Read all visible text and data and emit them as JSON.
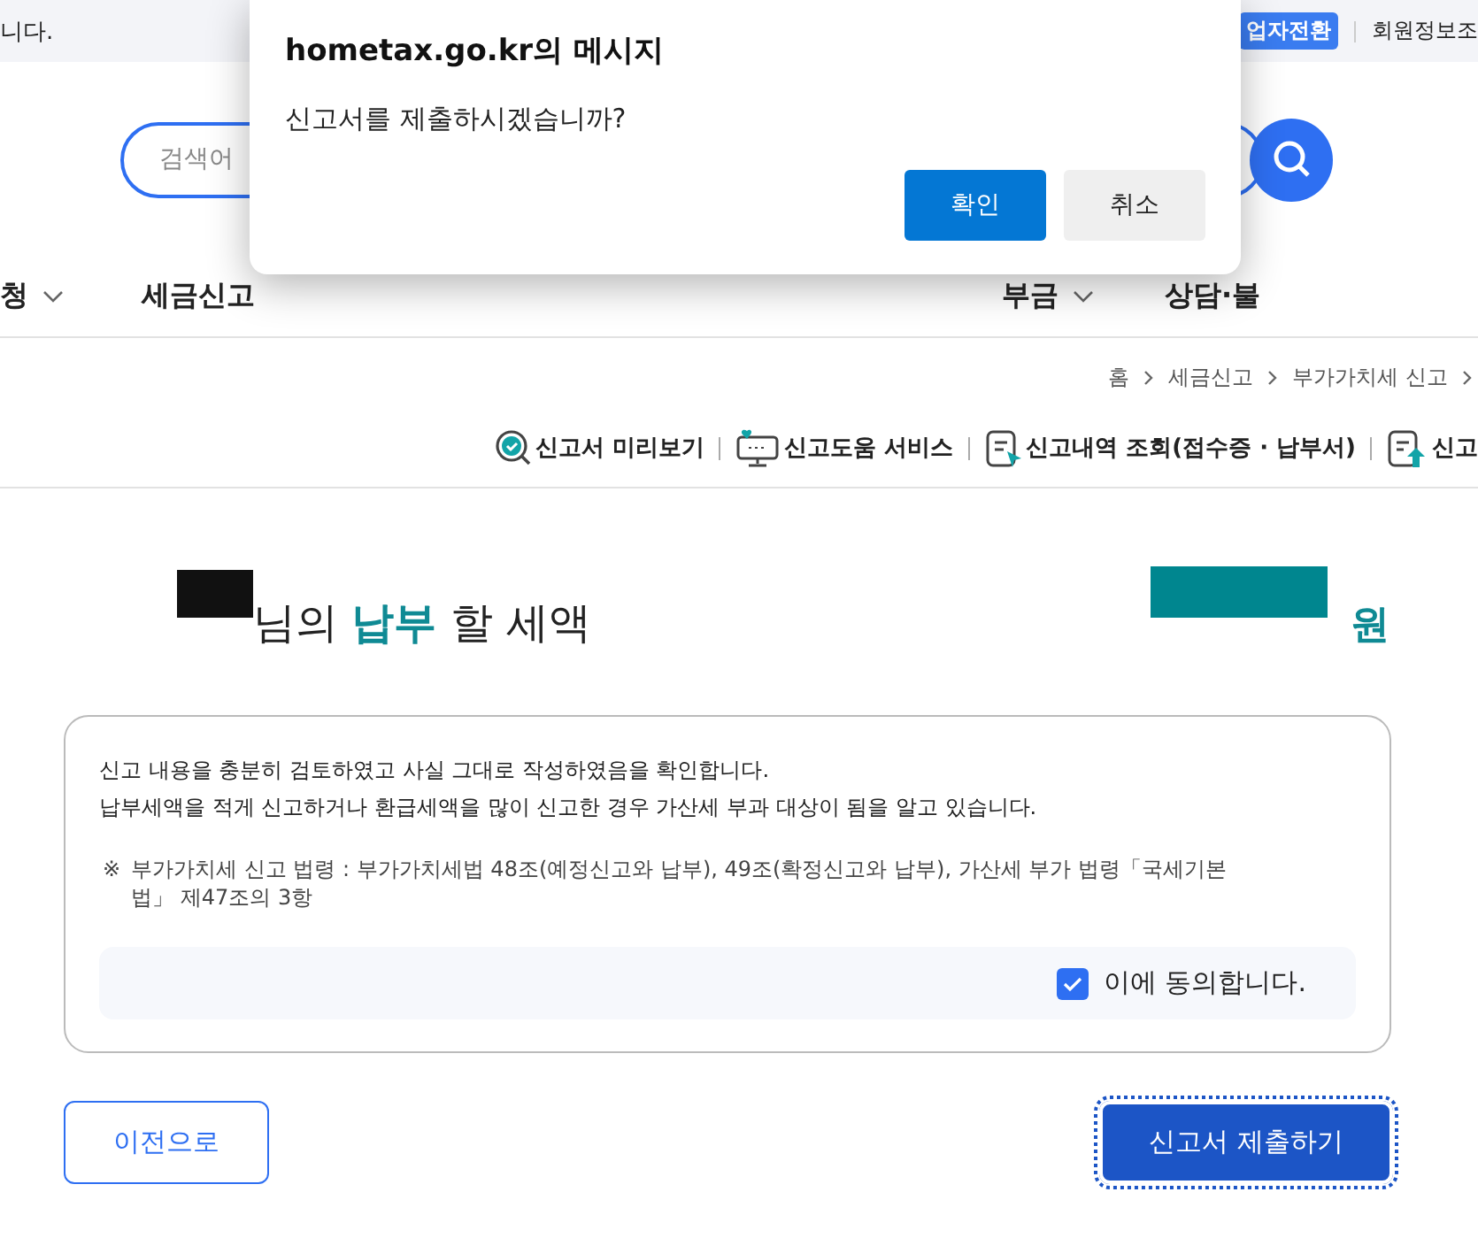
{
  "top_bar": {
    "notice": "니다.",
    "switch_badge": "업자전환",
    "member_link": "회원정보조"
  },
  "search": {
    "placeholder": "검색어"
  },
  "nav": [
    {
      "label": "청",
      "dropdown": true
    },
    {
      "label": "세금신고",
      "dropdown": false
    },
    {
      "label": "부금",
      "dropdown": true
    },
    {
      "label": "상담·불",
      "dropdown": false
    }
  ],
  "breadcrumb": [
    "홈",
    "세금신고",
    "부가가치세 신고"
  ],
  "tools": [
    {
      "kind": "preview",
      "label": "신고서 미리보기"
    },
    {
      "kind": "help",
      "label": "신고도움 서비스"
    },
    {
      "kind": "history",
      "label": "신고내역 조회(접수증 · 납부서)"
    },
    {
      "kind": "upload",
      "label": "신고"
    }
  ],
  "heading": {
    "suffix": "님의",
    "highlight": "납부",
    "rest": "할 세액",
    "unit": "원"
  },
  "notice": {
    "lines": [
      "신고 내용을 충분히 검토하였고 사실 그대로 작성하였음을 확인합니다.",
      "납부세액을 적게 신고하거나 환급세액을 많이 신고한 경우 가산세 부과 대상이 됨을 알고 있습니다."
    ],
    "note_mark": "※",
    "note": "부가가치세 신고 법령 :  부가가치세법 48조(예정신고와 납부), 49조(확정신고와 납부), 가산세 부가 법령「국세기본법」 제47조의 3항"
  },
  "agree": {
    "label": "이에 동의합니다.",
    "checked": true
  },
  "buttons": {
    "back": "이전으로",
    "submit": "신고서 제출하기"
  },
  "dialog": {
    "title": "hometax.go.kr의 메시지",
    "message": "신고서를 제출하시겠습니까?",
    "buttons": [
      {
        "label": "확인",
        "primary": true
      },
      {
        "label": "취소",
        "primary": false
      }
    ]
  }
}
